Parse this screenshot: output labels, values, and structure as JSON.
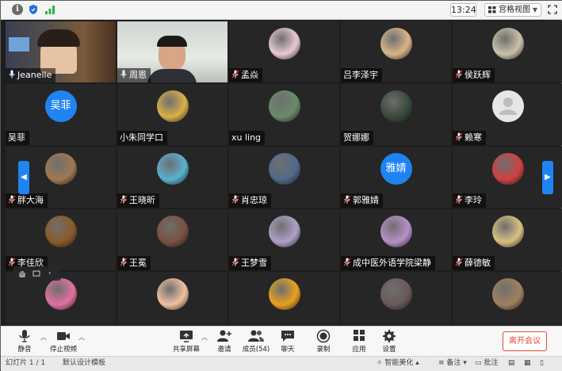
{
  "topbar": {
    "time": "13:24",
    "view_label": "宫格视图",
    "colors": {
      "bar": "#f4f4f4",
      "shield": "#1f6fe0",
      "signal": "#2fb34a"
    }
  },
  "participants": [
    {
      "name": "Jeanelle",
      "avatar": "video",
      "mic": "on",
      "icon": "video-feed"
    },
    {
      "name": "周恩",
      "avatar": "video",
      "mic": "on",
      "icon": "video-feed",
      "active": true
    },
    {
      "name": "孟焱",
      "avatar": "photo",
      "mic": "muted",
      "icon": "photo-avatar"
    },
    {
      "name": "吕李泽宇",
      "avatar": "photo",
      "mic": "none",
      "icon": "photo-avatar"
    },
    {
      "name": "侯跃辉",
      "avatar": "photo",
      "mic": "muted",
      "icon": "photo-avatar"
    },
    {
      "name": "吴菲",
      "avatar": "text",
      "avatar_text": "吴菲",
      "mic": "none"
    },
    {
      "name": "小朱同学口",
      "avatar": "photo",
      "mic": "none",
      "icon": "photo-avatar"
    },
    {
      "name": "xu ling",
      "avatar": "photo",
      "mic": "none",
      "icon": "photo-avatar"
    },
    {
      "name": "贺娜娜",
      "avatar": "photo",
      "mic": "none",
      "icon": "photo-avatar"
    },
    {
      "name": "赖寒",
      "avatar": "default",
      "mic": "muted",
      "icon": "person-icon"
    },
    {
      "name": "胖大海",
      "avatar": "photo",
      "mic": "muted",
      "icon": "photo-avatar"
    },
    {
      "name": "王晓昕",
      "avatar": "photo",
      "mic": "muted",
      "icon": "photo-avatar"
    },
    {
      "name": "肖忠琼",
      "avatar": "photo",
      "mic": "muted",
      "icon": "photo-avatar"
    },
    {
      "name": "郭雅婧",
      "avatar": "text",
      "avatar_text": "雅婧",
      "mic": "muted"
    },
    {
      "name": "李玲",
      "avatar": "photo",
      "mic": "muted",
      "icon": "photo-avatar"
    },
    {
      "name": "李佳欣",
      "avatar": "photo",
      "mic": "muted",
      "icon": "photo-avatar"
    },
    {
      "name": "王冕",
      "avatar": "photo",
      "mic": "muted",
      "icon": "photo-avatar"
    },
    {
      "name": "王梦雪",
      "avatar": "photo",
      "mic": "muted",
      "icon": "photo-avatar"
    },
    {
      "name": "成中医外语学院梁静",
      "avatar": "photo",
      "mic": "muted",
      "icon": "photo-avatar"
    },
    {
      "name": "薛德敏",
      "avatar": "photo",
      "mic": "muted",
      "icon": "photo-avatar"
    },
    {
      "name": "",
      "avatar": "photo",
      "mic": "none",
      "icon": "photo-avatar"
    },
    {
      "name": "",
      "avatar": "photo",
      "mic": "none",
      "icon": "photo-avatar"
    },
    {
      "name": "",
      "avatar": "photo",
      "mic": "none",
      "icon": "photo-avatar"
    },
    {
      "name": "",
      "avatar": "photo",
      "mic": "none",
      "icon": "photo-avatar"
    },
    {
      "name": "",
      "avatar": "photo",
      "mic": "none",
      "icon": "photo-avatar"
    }
  ],
  "avatar_colors": [
    "#5a4a3a",
    "#7a6a5a",
    "#e8c9d0",
    "#d9b48a",
    "#c9c1a8",
    "#1f84f2",
    "#d9b04a",
    "#6a8a6a",
    "#3a4a3a",
    "#e6e6e6",
    "#a07850",
    "#5ab0d0",
    "#506a8a",
    "#1f84f2",
    "#d04040",
    "#8a5a2a",
    "#7a5040",
    "#b0a0c8",
    "#b890c8",
    "#d8c080",
    "#e070a0",
    "#f0c0a0",
    "#e8a020",
    "#6a5a5a",
    "#a08060"
  ],
  "toolbar": {
    "mute": "静音",
    "stop_video": "停止视频",
    "share_screen": "共享屏幕",
    "invite": "邀请",
    "members": "成员(54)",
    "chat": "聊天",
    "record": "录制",
    "apps": "应用",
    "settings": "设置",
    "leave": "离开会议",
    "leave_color": "#e04a3b"
  },
  "statusbar": {
    "slide_info": "幻灯片 1 / 1",
    "template": "默认设计模板",
    "smart_beautify": "智能美化",
    "notes": "备注",
    "comments": "批注"
  }
}
